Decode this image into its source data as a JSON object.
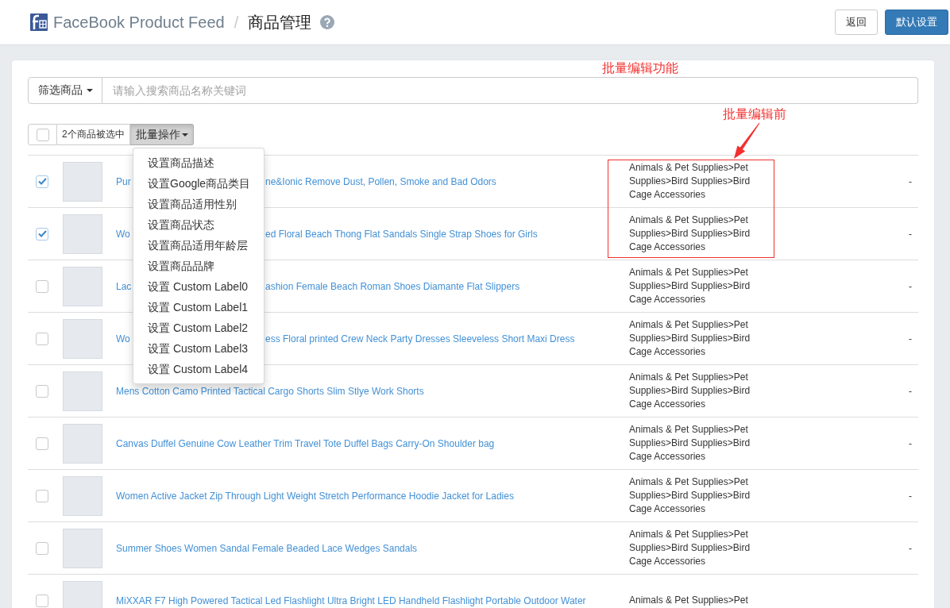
{
  "header": {
    "title": "FaceBook Product Feed",
    "separator": "/",
    "page_title": "商品管理",
    "buttons": [
      {
        "label": "返回",
        "kind": "default"
      },
      {
        "label": "默认设置",
        "kind": "primary"
      }
    ]
  },
  "search": {
    "filter_label": "筛选商品",
    "placeholder": "请输入搜索商品名称关键词"
  },
  "toolbar": {
    "select_all": {
      "checked": false
    },
    "selection_count": "2个商品被选中",
    "bulk_button": {
      "label": "批量操作",
      "expanded": true
    }
  },
  "bulk_menu": {
    "items": [
      "设置商品描述",
      "设置Google商品类目",
      "设置商品适用性别",
      "设置商品状态",
      "设置商品适用年龄层",
      "设置商品品牌",
      "设置 Custom Label0",
      "设置 Custom Label1",
      "设置 Custom Label2",
      "设置 Custom Label3",
      "设置 Custom Label4"
    ]
  },
  "annotations": [
    {
      "kind": "label",
      "text": "批量编辑功能"
    },
    {
      "kind": "callout",
      "text": "批量编辑前"
    }
  ],
  "table": {
    "rows": [
      {
        "selected": true,
        "title_parts": [
          "Pur",
          "ne&Ionic Remove Dust, Pollen, Smoke and Bad Odors"
        ],
        "category": "Animals & Pet Supplies>Pet Supplies>Bird Supplies>Bird Cage Accessories",
        "column_4": "-"
      },
      {
        "selected": true,
        "title_parts": [
          "Wo",
          "ed Floral Beach Thong Flat Sandals Single Strap Shoes for Girls"
        ],
        "category": "Animals & Pet Supplies>Pet Supplies>Bird Supplies>Bird Cage Accessories",
        "column_4": "-"
      },
      {
        "selected": false,
        "title_parts": [
          "Lac",
          "ashion Female Beach Roman Shoes Diamante Flat Slippers"
        ],
        "category": "Animals & Pet Supplies>Pet Supplies>Bird Supplies>Bird Cage Accessories",
        "column_4": "-"
      },
      {
        "selected": false,
        "title_parts": [
          "Wo",
          "ess Floral printed Crew Neck Party Dresses Sleeveless Short Maxi Dress"
        ],
        "category": "Animals & Pet Supplies>Pet Supplies>Bird Supplies>Bird Cage Accessories",
        "column_4": "-"
      },
      {
        "selected": false,
        "title_parts": [
          "Mens Cotton Camo Printed Tactical Cargo Shorts Slim Stlye Work Shorts"
        ],
        "category": "Animals & Pet Supplies>Pet Supplies>Bird Supplies>Bird Cage Accessories",
        "column_4": "-"
      },
      {
        "selected": false,
        "title_parts": [
          "Canvas Duffel Genuine Cow Leather Trim Travel Tote Duffel Bags Carry-On Shoulder bag"
        ],
        "category": "Animals & Pet Supplies>Pet Supplies>Bird Supplies>Bird Cage Accessories",
        "column_4": "-"
      },
      {
        "selected": false,
        "title_parts": [
          "Women Active Jacket Zip Through Light Weight Stretch Performance Hoodie Jacket for Ladies"
        ],
        "category": "Animals & Pet Supplies>Pet Supplies>Bird Supplies>Bird Cage Accessories",
        "column_4": "-"
      },
      {
        "selected": false,
        "title_parts": [
          "Summer Shoes Women Sandal Female Beaded Lace Wedges Sandals"
        ],
        "category": "Animals & Pet Supplies>Pet Supplies>Bird Supplies>Bird Cage Accessories",
        "column_4": "-"
      },
      {
        "selected": false,
        "title_parts": [
          "MiXXAR F7 High Powered Tactical Led Flashlight Ultra Bright LED Handheld Flashlight Portable Outdoor Water"
        ],
        "category": "Animals & Pet Supplies>Pet"
      }
    ]
  }
}
